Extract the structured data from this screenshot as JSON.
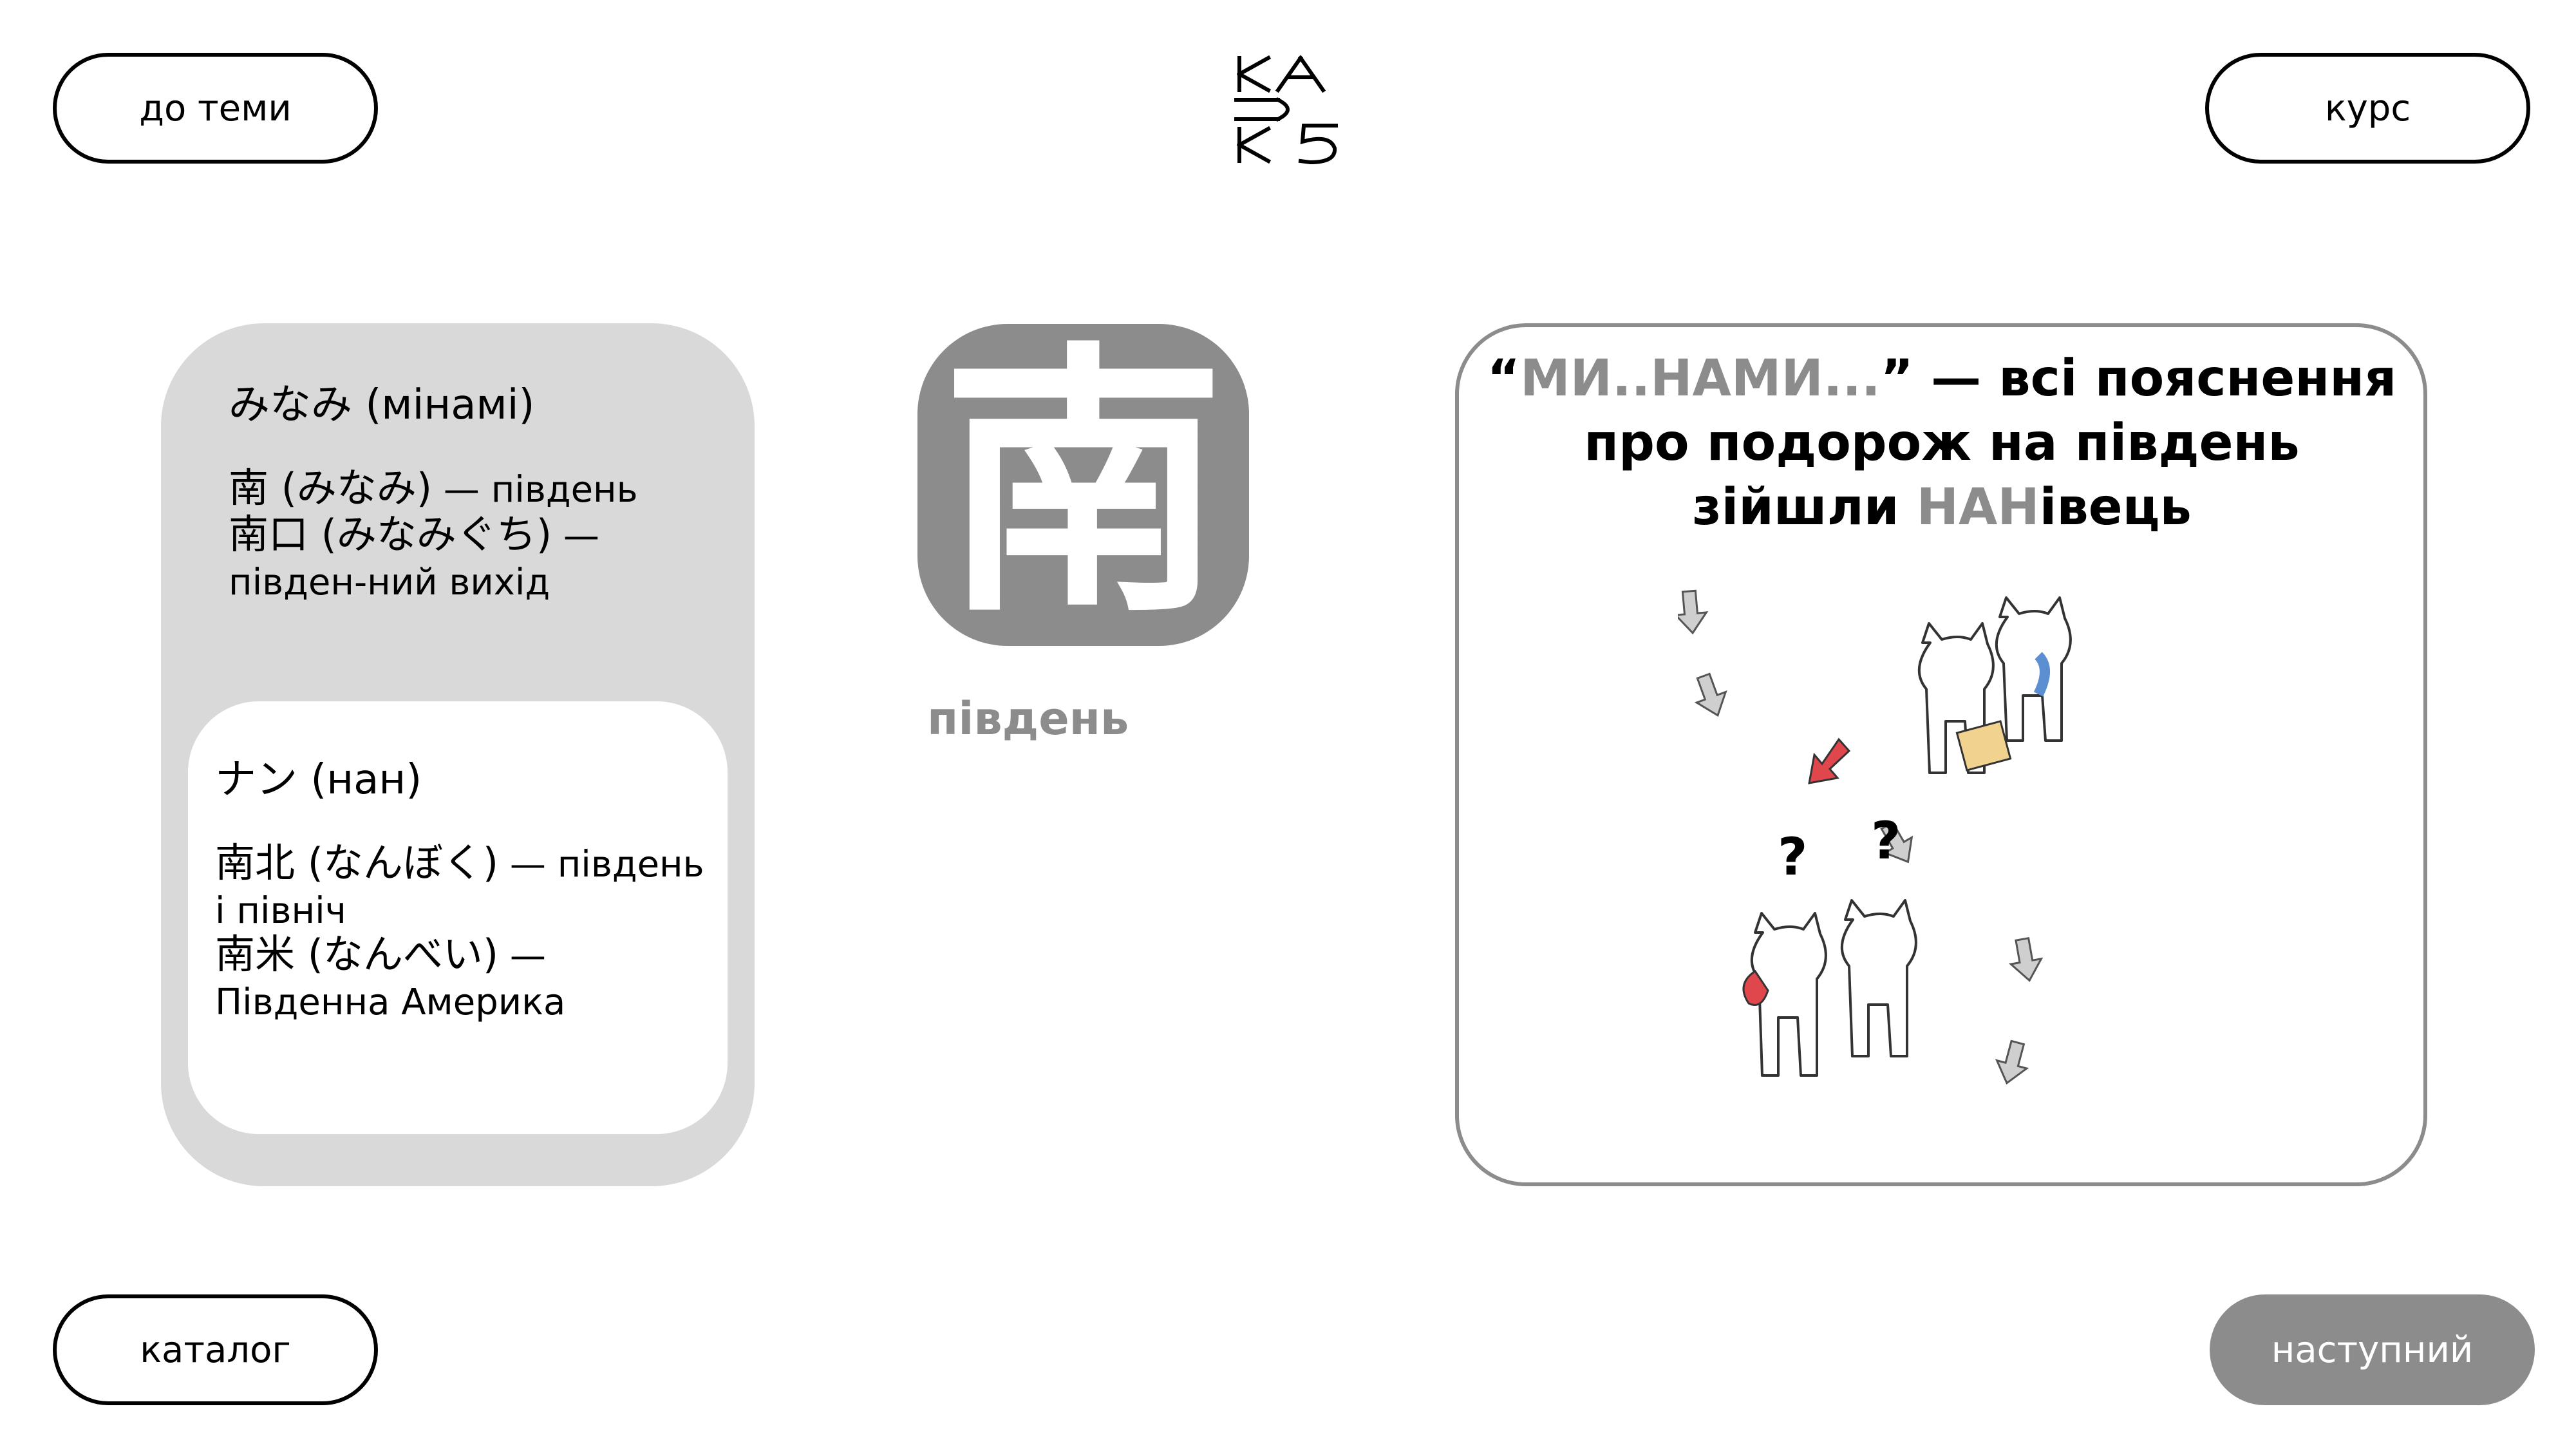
{
  "nav": {
    "back_to_topic": "до теми",
    "course": "курс",
    "catalog": "каталог",
    "next": "наступний"
  },
  "kun_reading": {
    "title": "みなみ (мінамі)",
    "examples": [
      {
        "word": "南 (みなみ)",
        "meaning": " — південь"
      },
      {
        "word": "南口 (みなみぐち)",
        "meaning": " — півден-ний вихід"
      }
    ]
  },
  "on_reading": {
    "title": "ナン (нан)",
    "examples": [
      {
        "word": "南北 (なんぼく)",
        "meaning": " — південь і північ"
      },
      {
        "word": "南米 (なんべい)",
        "meaning": " — Південна Америка"
      }
    ]
  },
  "kanji": {
    "character": "南",
    "meaning": "південь"
  },
  "mnemonic": {
    "open_quote": "“",
    "highlight_1": "МИ..НАМИ...",
    "middle": "” — всі пояснення про подорож на південь зійшли ",
    "highlight_2": "НАН",
    "end": "івець"
  },
  "colors": {
    "accent_gray": "#8c8c8c",
    "card_gray": "#d9d9d9",
    "arrow_red": "#e0474c"
  },
  "icons": {
    "logo": "kanji-logo",
    "illustration": "cats-looking-for-south"
  }
}
